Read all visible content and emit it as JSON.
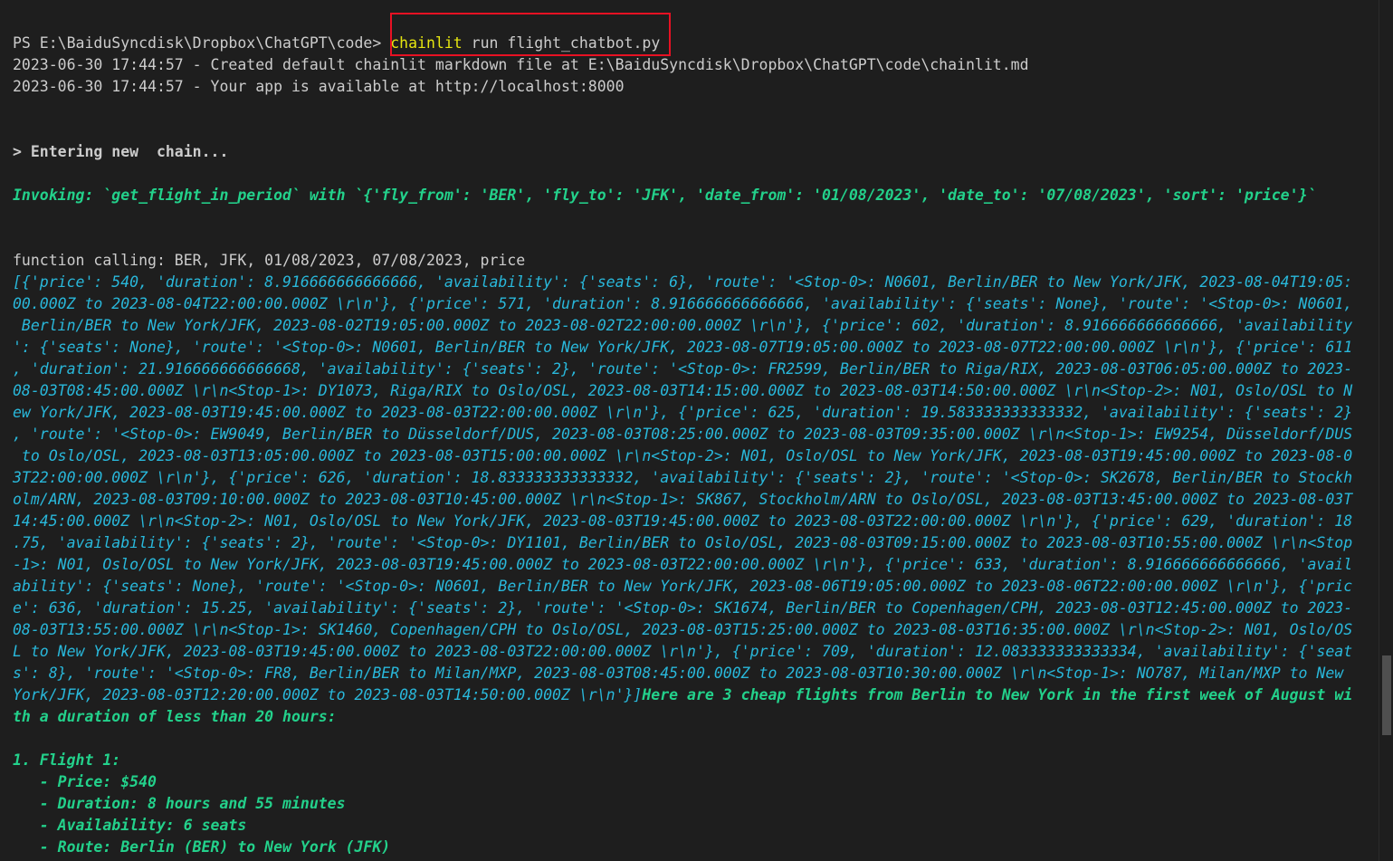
{
  "terminal": {
    "prompt": "PS E:\\BaiduSyncdisk\\Dropbox\\ChatGPT\\code> ",
    "command_program": "chainlit",
    "command_args": " run flight_chatbot.py",
    "log_created": "2023-06-30 17:44:57 - Created default chainlit markdown file at E:\\BaiduSyncdisk\\Dropbox\\ChatGPT\\code\\chainlit.md",
    "log_available": "2023-06-30 17:44:57 - Your app is available at http://localhost:8000",
    "entering_chain": "> Entering new  chain...",
    "invoking": "Invoking: `get_flight_in_period` with `{'fly_from': 'BER', 'fly_to': 'JFK', 'date_from': '01/08/2023', 'date_to': '07/08/2023', 'sort': 'price'}`",
    "function_calling": "function calling: BER, JFK, 01/08/2023, 07/08/2023, price",
    "result_lines": [
      "[{'price': 540, 'duration': 8.916666666666666, 'availability': {'seats': 6}, 'route': '<Stop-0>: N0601, Berlin/BER to New York/JFK, 2023-08-04T19:05:",
      "00.000Z to 2023-08-04T22:00:00.000Z \\r\\n'}, {'price': 571, 'duration': 8.916666666666666, 'availability': {'seats': None}, 'route': '<Stop-0>: N0601,",
      " Berlin/BER to New York/JFK, 2023-08-02T19:05:00.000Z to 2023-08-02T22:00:00.000Z \\r\\n'}, {'price': 602, 'duration': 8.916666666666666, 'availability",
      "': {'seats': None}, 'route': '<Stop-0>: N0601, Berlin/BER to New York/JFK, 2023-08-07T19:05:00.000Z to 2023-08-07T22:00:00.000Z \\r\\n'}, {'price': 611",
      ", 'duration': 21.916666666666668, 'availability': {'seats': 2}, 'route': '<Stop-0>: FR2599, Berlin/BER to Riga/RIX, 2023-08-03T06:05:00.000Z to 2023-",
      "08-03T08:45:00.000Z \\r\\n<Stop-1>: DY1073, Riga/RIX to Oslo/OSL, 2023-08-03T14:15:00.000Z to 2023-08-03T14:50:00.000Z \\r\\n<Stop-2>: N01, Oslo/OSL to N",
      "ew York/JFK, 2023-08-03T19:45:00.000Z to 2023-08-03T22:00:00.000Z \\r\\n'}, {'price': 625, 'duration': 19.583333333333332, 'availability': {'seats': 2}",
      ", 'route': '<Stop-0>: EW9049, Berlin/BER to Düsseldorf/DUS, 2023-08-03T08:25:00.000Z to 2023-08-03T09:35:00.000Z \\r\\n<Stop-1>: EW9254, Düsseldorf/DUS",
      " to Oslo/OSL, 2023-08-03T13:05:00.000Z to 2023-08-03T15:00:00.000Z \\r\\n<Stop-2>: N01, Oslo/OSL to New York/JFK, 2023-08-03T19:45:00.000Z to 2023-08-0",
      "3T22:00:00.000Z \\r\\n'}, {'price': 626, 'duration': 18.833333333333332, 'availability': {'seats': 2}, 'route': '<Stop-0>: SK2678, Berlin/BER to Stockh",
      "olm/ARN, 2023-08-03T09:10:00.000Z to 2023-08-03T10:45:00.000Z \\r\\n<Stop-1>: SK867, Stockholm/ARN to Oslo/OSL, 2023-08-03T13:45:00.000Z to 2023-08-03T",
      "14:45:00.000Z \\r\\n<Stop-2>: N01, Oslo/OSL to New York/JFK, 2023-08-03T19:45:00.000Z to 2023-08-03T22:00:00.000Z \\r\\n'}, {'price': 629, 'duration': 18",
      ".75, 'availability': {'seats': 2}, 'route': '<Stop-0>: DY1101, Berlin/BER to Oslo/OSL, 2023-08-03T09:15:00.000Z to 2023-08-03T10:55:00.000Z \\r\\n<Stop",
      "-1>: N01, Oslo/OSL to New York/JFK, 2023-08-03T19:45:00.000Z to 2023-08-03T22:00:00.000Z \\r\\n'}, {'price': 633, 'duration': 8.916666666666666, 'avail",
      "ability': {'seats': None}, 'route': '<Stop-0>: N0601, Berlin/BER to New York/JFK, 2023-08-06T19:05:00.000Z to 2023-08-06T22:00:00.000Z \\r\\n'}, {'pric",
      "e': 636, 'duration': 15.25, 'availability': {'seats': 2}, 'route': '<Stop-0>: SK1674, Berlin/BER to Copenhagen/CPH, 2023-08-03T12:45:00.000Z to 2023-",
      "08-03T13:55:00.000Z \\r\\n<Stop-1>: SK1460, Copenhagen/CPH to Oslo/OSL, 2023-08-03T15:25:00.000Z to 2023-08-03T16:35:00.000Z \\r\\n<Stop-2>: N01, Oslo/OS",
      "L to New York/JFK, 2023-08-03T19:45:00.000Z to 2023-08-03T22:00:00.000Z \\r\\n'}, {'price': 709, 'duration': 12.083333333333334, 'availability': {'seat",
      "s': 8}, 'route': '<Stop-0>: FR8, Berlin/BER to Milan/MXP, 2023-08-03T08:45:00.000Z to 2023-08-03T10:30:00.000Z \\r\\n<Stop-1>: NO787, Milan/MXP to New",
      "York/JFK, 2023-08-03T12:20:00.000Z to 2023-08-03T14:50:00.000Z \\r\\n'}]"
    ],
    "answer_start": "Here are 3 cheap flights from Berlin to New York in the first week of August wi",
    "answer_wrap": "th a duration of less than 20 hours:",
    "flight_heading": "1. Flight 1:",
    "flight_details": [
      "   - Price: $540",
      "   - Duration: 8 hours and 55 minutes",
      "   - Availability: 6 seats",
      "   - Route: Berlin (BER) to New York (JFK)"
    ]
  },
  "colors": {
    "background": "#1e1e1e",
    "plain_text": "#cccccc",
    "agent_green": "#23d18b",
    "result_cyan": "#29b8db",
    "command_yellow": "#e5e510",
    "highlight_red": "#e81123"
  }
}
